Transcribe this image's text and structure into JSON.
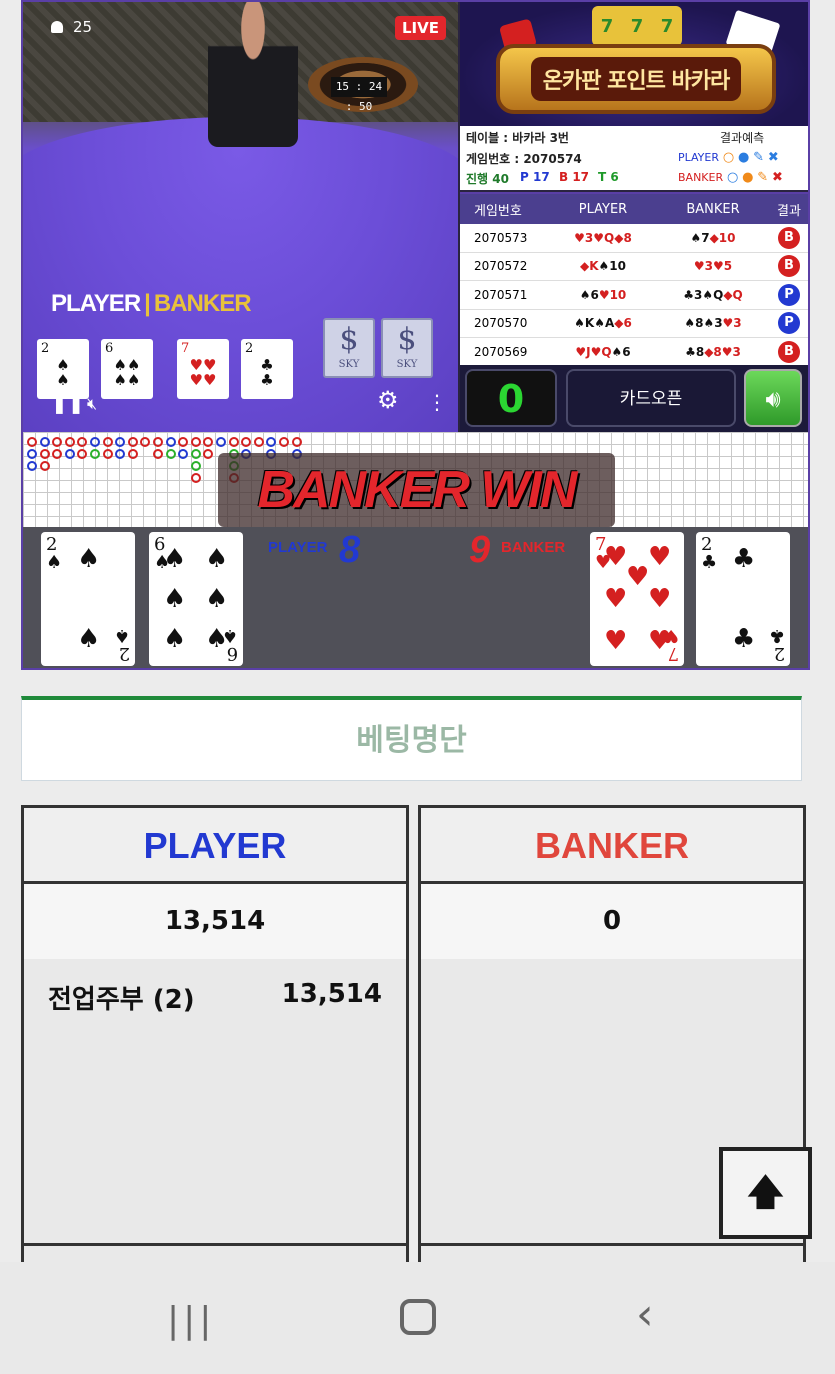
{
  "video": {
    "viewers": "25",
    "live_badge": "LIVE",
    "timer": "15 : 24 : 50",
    "table_logo": {
      "player": "PLAYER",
      "banker": "BANKER"
    },
    "shoe_label": "SKY"
  },
  "banner": {
    "slot": [
      "7",
      "7",
      "7"
    ],
    "title": "온카판 포인트 바카라"
  },
  "info": {
    "table": "테이블 : 바카라 3번",
    "prediction_label": "결과예측",
    "game_no": "게임번호 : 2070574",
    "progress": "진행 40",
    "p_count": "P 17",
    "b_count": "B 17",
    "t_count": "T 6",
    "player_label": "PLAYER",
    "banker_label": "BANKER"
  },
  "history": {
    "headers": [
      "게임번호",
      "PLAYER",
      "BANKER",
      "결과"
    ],
    "rows": [
      {
        "game": "2070573",
        "player": [
          "♥3",
          "♥Q",
          "◆8"
        ],
        "banker": [
          "♠7",
          "◆10"
        ],
        "result": "B"
      },
      {
        "game": "2070572",
        "player": [
          "◆K",
          "♠10"
        ],
        "banker": [
          "♥3",
          "♥5"
        ],
        "result": "B"
      },
      {
        "game": "2070571",
        "player": [
          "♠6",
          "♥10"
        ],
        "banker": [
          "♣3",
          "♠Q",
          "◆Q"
        ],
        "result": "P"
      },
      {
        "game": "2070570",
        "player": [
          "♠K",
          "♠A",
          "◆6"
        ],
        "banker": [
          "♠8",
          "♠3",
          "♥3"
        ],
        "result": "P"
      },
      {
        "game": "2070569",
        "player": [
          "♥J",
          "♥Q",
          "♠6"
        ],
        "banker": [
          "♣8",
          "◆8",
          "♥3"
        ],
        "result": "B"
      }
    ]
  },
  "controls": {
    "count": "0",
    "card_open": "카드오픈",
    "sound_icon": "speaker-icon"
  },
  "result": {
    "banner_text": "BANKER WIN",
    "player_label": "PLAYER",
    "player_score": "8",
    "banker_label": "BANKER",
    "banker_score": "9",
    "player_cards": [
      {
        "rank": "2",
        "suit": "♠",
        "color": "black"
      },
      {
        "rank": "6",
        "suit": "♠",
        "color": "black"
      }
    ],
    "banker_cards": [
      {
        "rank": "7",
        "suit": "♥",
        "color": "red"
      },
      {
        "rank": "2",
        "suit": "♣",
        "color": "black"
      }
    ]
  },
  "betting": {
    "title": "베팅명단",
    "player": {
      "header": "PLAYER",
      "total": "13,514",
      "entries": [
        {
          "name": "전업주부 (2)",
          "amount": "13,514"
        }
      ]
    },
    "banker": {
      "header": "BANKER",
      "total": "0",
      "entries": []
    }
  },
  "colors": {
    "player": "#2239d1",
    "banker": "#e0463c",
    "accent_green": "#1f8a3a"
  },
  "scroll_top": {
    "icon": "arrow-up-icon",
    "glyph": "🡅"
  },
  "navbar": {
    "recent": "|||",
    "back": "‹"
  }
}
